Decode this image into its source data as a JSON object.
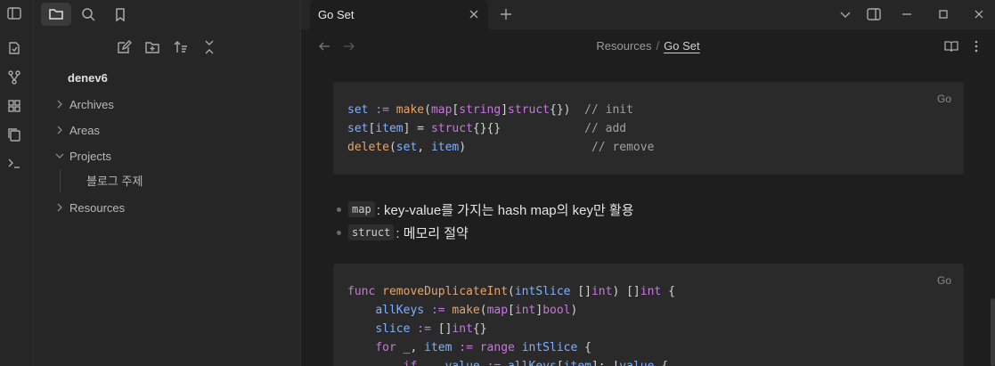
{
  "sidebar": {
    "vault_name": "denev6",
    "tree": [
      {
        "label": "Archives",
        "expanded": false
      },
      {
        "label": "Areas",
        "expanded": false
      },
      {
        "label": "Projects",
        "expanded": true
      },
      {
        "label": "블로그 주제",
        "child": true
      },
      {
        "label": "Resources",
        "expanded": false
      }
    ]
  },
  "tab": {
    "title": "Go Set"
  },
  "breadcrumb": {
    "parent": "Resources",
    "separator": "/",
    "current": "Go Set"
  },
  "code1": {
    "lang": "Go"
  },
  "code2": {
    "lang": "Go"
  },
  "bullets": [
    {
      "code": "map",
      "text": ": key-value를 가지는 hash map의 key만 활용"
    },
    {
      "code": "struct",
      "text": ": 메모리 절약"
    }
  ],
  "colors": {
    "keyword": "#c678dd",
    "builtin": "#e5a56b",
    "identifier": "#7fb0ff",
    "background": "#1e1e1e",
    "sidebar": "#262626"
  }
}
